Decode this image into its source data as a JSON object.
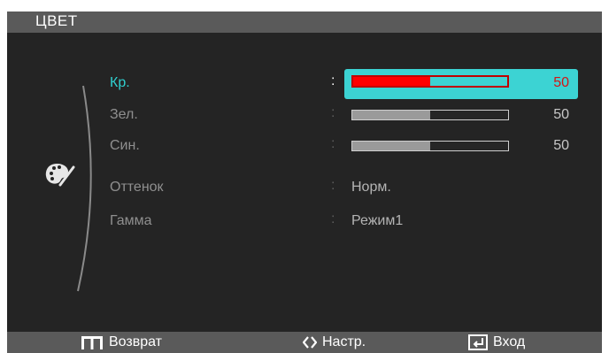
{
  "title": "ЦВЕТ",
  "menu": [
    {
      "label": "Кр.",
      "type": "slider",
      "value": 50,
      "fraction": 0.5,
      "selected": true
    },
    {
      "label": "Зел.",
      "type": "slider",
      "value": 50,
      "fraction": 0.5,
      "selected": false
    },
    {
      "label": "Син.",
      "type": "slider",
      "value": 50,
      "fraction": 0.5,
      "selected": false
    },
    {
      "label": "Оттенок",
      "type": "text",
      "value": "Норм.",
      "selected": false
    },
    {
      "label": "Гамма",
      "type": "text",
      "value": "Режим1",
      "selected": false
    }
  ],
  "separator": ":",
  "footer": {
    "return_label": "Возврат",
    "adjust_label": "Настр.",
    "enter_label": "Вход"
  },
  "colors": {
    "background": "#242424",
    "bar": "#5a5a5a",
    "accent": "#3cd3d3",
    "active_fill": "#ff0000",
    "active_value": "#d41515"
  },
  "icons": {
    "category": "palette-icon",
    "return": "menu-icon",
    "adjust": "left-right-arrow-icon",
    "enter": "enter-icon"
  }
}
